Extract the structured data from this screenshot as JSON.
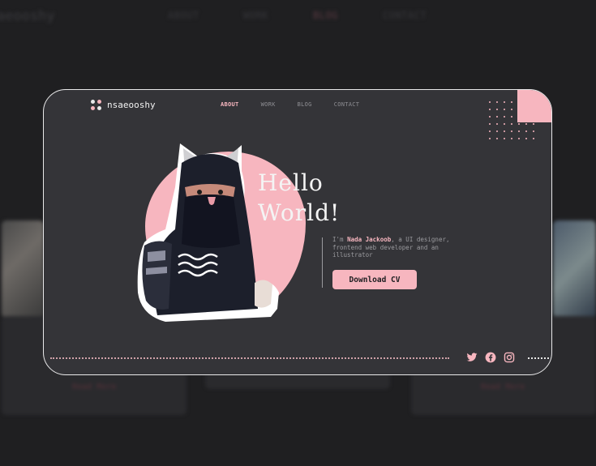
{
  "background": {
    "logo": "aeooshy",
    "nav": [
      {
        "label": "ABOUT",
        "active": false
      },
      {
        "label": "WORK",
        "active": false
      },
      {
        "label": "BLOG",
        "active": true
      },
      {
        "label": "CONTACT",
        "active": false
      }
    ],
    "read_more": [
      "Read More",
      "Read More"
    ]
  },
  "header": {
    "logo_text": "nsaeooshy",
    "logo_dot_colors": [
      "#e9e9ea",
      "#f7b6bf",
      "#f7b6bf",
      "#e9e9ea"
    ],
    "nav": [
      {
        "label": "ABOUT",
        "active": true
      },
      {
        "label": "WORK",
        "active": false
      },
      {
        "label": "BLOG",
        "active": false
      },
      {
        "label": "CONTACT",
        "active": false
      }
    ]
  },
  "hero": {
    "line1": "Hello",
    "line2": "World!",
    "intro_prefix": "I'm ",
    "name": "Nada Jackoob",
    "intro_suffix": ", a UI designer, frontend web developer and an illustrator",
    "button_label": "Download CV"
  },
  "social": [
    {
      "name": "twitter-icon"
    },
    {
      "name": "facebook-icon"
    },
    {
      "name": "instagram-icon"
    }
  ],
  "colors": {
    "accent": "#f7b6bf",
    "card_bg": "#343438",
    "page_bg": "#1f1f21"
  }
}
